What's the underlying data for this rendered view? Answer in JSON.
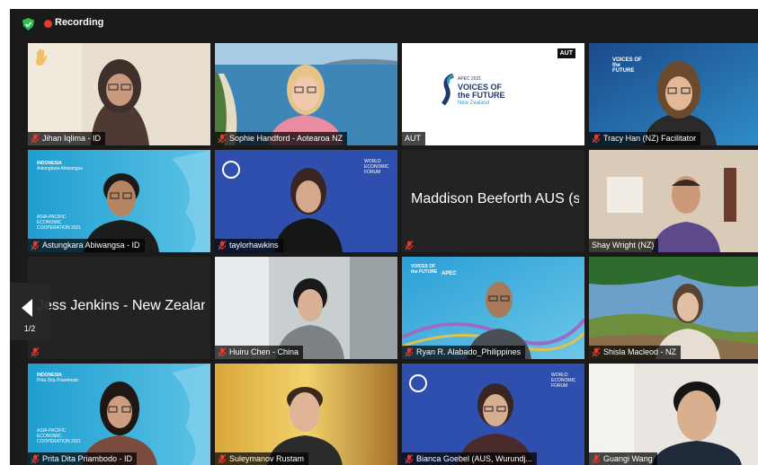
{
  "topbar": {
    "recording_label": "Recording",
    "recording_color": "#e8392e",
    "shield_color": "#2dbf4a"
  },
  "pager": {
    "page_label": "1/2"
  },
  "tiles": [
    {
      "name": "Jihan Iqlima - ID",
      "hand_raised": true
    },
    {
      "name": "Sophie Handford - Aotearoa NZ"
    },
    {
      "name": "AUT",
      "logo": "AUT",
      "slide_small": "APEC 2021",
      "slide_title_1": "VOICES OF",
      "slide_title_2": "the FUTURE",
      "slide_sub": "New Zealand"
    },
    {
      "name": "Tracy Han (NZ) Facilitator",
      "banner": "VOICES OF the FUTURE"
    },
    {
      "name": "Astungkara Abiwangsa - ID",
      "banner_top": "INDONESIA",
      "banner_sub": "Astungkara Abiwangsa",
      "banner_bottom": "ASIA-PACIFIC ECONOMIC COOPERATION 2021"
    },
    {
      "name": "taylorhawkins",
      "banner_right": "WORLD ECONOMIC FORUM"
    },
    {
      "name": "Maddison Beeforth AUS (s...",
      "video_off": true
    },
    {
      "name": "Shay Wright (NZ)",
      "active_speaker": true
    },
    {
      "name": "Jess Jenkins - New Zealand",
      "video_off": true
    },
    {
      "name": "Huiru Chen - China"
    },
    {
      "name": "Ryan R. Alabado_Philippines",
      "banner": "VOICES OF the FUTURE",
      "banner_right": "APEC"
    },
    {
      "name": "Shisla Macleod - NZ"
    },
    {
      "name": "Prita Dita Priambodo - ID",
      "banner_top": "INDONESIA",
      "banner_sub": "Prita Dita Priambodo",
      "banner_bottom": "ASIA-PACIFIC ECONOMIC COOPERATION 2021"
    },
    {
      "name": "Suleymanov Rustam"
    },
    {
      "name": "Bianca Goebel (AUS, Wurundj...",
      "banner_right": "WORLD ECONOMIC FORUM"
    },
    {
      "name": "Guangi Wang"
    }
  ]
}
